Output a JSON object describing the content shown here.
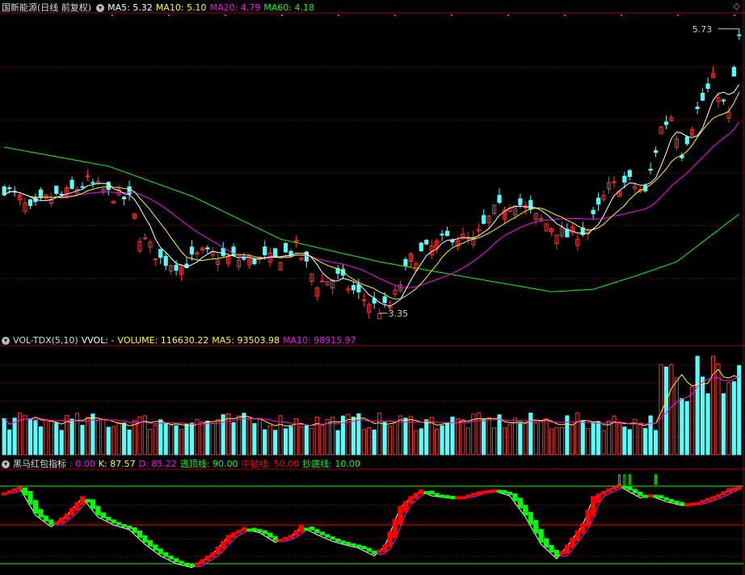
{
  "colors": {
    "bg": "#000000",
    "up": "#ff3232",
    "down": "#54ffff",
    "grid": "#7a0000",
    "border": "#a00000",
    "ma5": "#ffffff",
    "ma10": "#ffff00",
    "ma20": "#ff00ff",
    "ma60": "#00ff00",
    "kline": "#ffffff",
    "dline": "#ff00ff",
    "escape": "#00ff00",
    "axis": "#ff0000",
    "bottom": "#00ff00",
    "kd_up": "#ff0000",
    "kd_down": "#00ff00"
  },
  "main_header": {
    "title": "国新能源(日线 前复权)",
    "items": [
      {
        "label": "MA5: 5.32",
        "color": "#ffffff"
      },
      {
        "label": "MA10: 5.10",
        "color": "#ffff00"
      },
      {
        "label": "MA20: 4.79",
        "color": "#ff00ff"
      },
      {
        "label": "MA60: 4.18",
        "color": "#00ff00"
      }
    ],
    "corner_icon": "diamond-icon"
  },
  "vol_header": {
    "title": "VOL-TDX(5,10)",
    "items": [
      {
        "label": "VVOL: -",
        "color": "#ffffff"
      },
      {
        "label": "VOLUME: 116630.22",
        "color": "#ffff00"
      },
      {
        "label": "MA5: 93503.98",
        "color": "#ffff00"
      },
      {
        "label": "MA10: 98915.97",
        "color": "#ff00ff"
      }
    ]
  },
  "ind_header": {
    "title": "黑马红包指标",
    "items": [
      {
        "label": ": 0.00",
        "color": "#ff00ff"
      },
      {
        "label": "K: 87.57",
        "color": "#ffff00"
      },
      {
        "label": "D: 85.22",
        "color": "#ff00ff"
      },
      {
        "label": "逃顶线: 90.00",
        "color": "#00ff00"
      },
      {
        "label": "中轴线: 50.00",
        "color": "#ff0000"
      },
      {
        "label": "抄底线: 10.00",
        "color": "#00ff00"
      }
    ]
  },
  "chart_data": [
    {
      "type": "candlestick",
      "ylim": [
        3.2,
        5.85
      ],
      "high_label": "5.73",
      "low_label": "3.35",
      "ma60_anchors": [
        [
          0,
          4.74
        ],
        [
          20,
          4.58
        ],
        [
          36,
          4.33
        ],
        [
          53,
          3.97
        ],
        [
          72,
          3.78
        ],
        [
          89,
          3.65
        ],
        [
          105,
          3.53
        ],
        [
          113,
          3.55
        ],
        [
          121,
          3.66
        ],
        [
          129,
          3.78
        ],
        [
          141,
          4.18
        ]
      ]
    },
    {
      "type": "bar",
      "name": "volume",
      "ylim": [
        0,
        180000
      ]
    },
    {
      "type": "line",
      "name": "indicator",
      "ylim": [
        0,
        100
      ],
      "levels": [
        90,
        50,
        10
      ],
      "k_anchors": [
        [
          0,
          82
        ],
        [
          3,
          88
        ],
        [
          6,
          60
        ],
        [
          9,
          48
        ],
        [
          12,
          60
        ],
        [
          15,
          78
        ],
        [
          18,
          58
        ],
        [
          21,
          50
        ],
        [
          24,
          45
        ],
        [
          27,
          30
        ],
        [
          30,
          18
        ],
        [
          33,
          10
        ],
        [
          36,
          6
        ],
        [
          40,
          20
        ],
        [
          43,
          38
        ],
        [
          46,
          46
        ],
        [
          49,
          42
        ],
        [
          52,
          32
        ],
        [
          55,
          38
        ],
        [
          57,
          48
        ],
        [
          60,
          40
        ],
        [
          63,
          33
        ],
        [
          65,
          30
        ],
        [
          68,
          26
        ],
        [
          71,
          18
        ],
        [
          73,
          28
        ],
        [
          76,
          68
        ],
        [
          78,
          78
        ],
        [
          80,
          85
        ],
        [
          82,
          80
        ],
        [
          85,
          78
        ],
        [
          88,
          78
        ],
        [
          91,
          83
        ],
        [
          94,
          85
        ],
        [
          97,
          80
        ],
        [
          100,
          58
        ],
        [
          103,
          30
        ],
        [
          106,
          15
        ],
        [
          108,
          28
        ],
        [
          111,
          50
        ],
        [
          113,
          78
        ],
        [
          116,
          86
        ],
        [
          118,
          90
        ],
        [
          120,
          84
        ],
        [
          122,
          78
        ],
        [
          124,
          80
        ],
        [
          127,
          74
        ],
        [
          130,
          70
        ],
        [
          133,
          72
        ],
        [
          137,
          80
        ],
        [
          139,
          86
        ],
        [
          141,
          88
        ]
      ]
    }
  ]
}
